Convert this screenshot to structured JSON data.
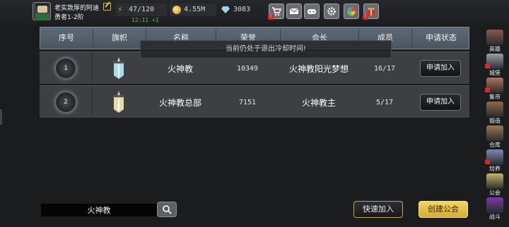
{
  "player": {
    "name": "老实敦厚的阿迪",
    "rank": "勇者1-2阶"
  },
  "stats": {
    "energy": "47/120",
    "energy_regen": "12:11 +1",
    "gold": "4.55M",
    "gems": "3083"
  },
  "top_menu": [
    {
      "icon": "shop-cart-icon"
    },
    {
      "icon": "mail-icon"
    },
    {
      "icon": "gamepad-icon"
    },
    {
      "icon": "gear-icon"
    },
    {
      "icon": "color-wheel-icon"
    },
    {
      "icon": "gift-icon"
    }
  ],
  "table": {
    "headers": [
      "序号",
      "旗帜",
      "名称",
      "荣誉",
      "会长",
      "成员",
      "申请状态"
    ],
    "rows": [
      {
        "index": "1",
        "banner_color": "#a8dde8",
        "name": "火神教",
        "honor": "10349",
        "leader": "火神教阳光梦想",
        "members": "16/17",
        "action": "申请加入"
      },
      {
        "index": "2",
        "banner_color": "#e8dba6",
        "name": "火神教总部",
        "honor": "7151",
        "leader": "火神教主",
        "members": "5/17",
        "action": "申请加入"
      }
    ]
  },
  "toast": "当前仍处于退出冷却时间!",
  "search": {
    "value": "火神教"
  },
  "buttons": {
    "quick_join": "快速加入",
    "create_guild": "创建公会"
  },
  "sidebar": [
    {
      "label": "英雄",
      "icon": "hero-icon",
      "color": "#8a5a4a",
      "badge": false
    },
    {
      "label": "城堡",
      "icon": "castle-icon",
      "color": "#9aa0a8",
      "badge": true
    },
    {
      "label": "集市",
      "icon": "market-icon",
      "color": "#b0745a",
      "badge": true
    },
    {
      "label": "锻造",
      "icon": "anvil-icon",
      "color": "#8a6a4a",
      "badge": false
    },
    {
      "label": "仓库",
      "icon": "warehouse-icon",
      "color": "#9a7a50",
      "badge": false
    },
    {
      "label": "培养",
      "icon": "train-icon",
      "color": "#7a8ab0",
      "badge": true
    },
    {
      "label": "公会",
      "icon": "guild-icon",
      "color": "#c9b46a",
      "badge": false
    },
    {
      "label": "战斗",
      "icon": "battle-icon",
      "color": "#7a3aa8",
      "badge": false
    }
  ]
}
